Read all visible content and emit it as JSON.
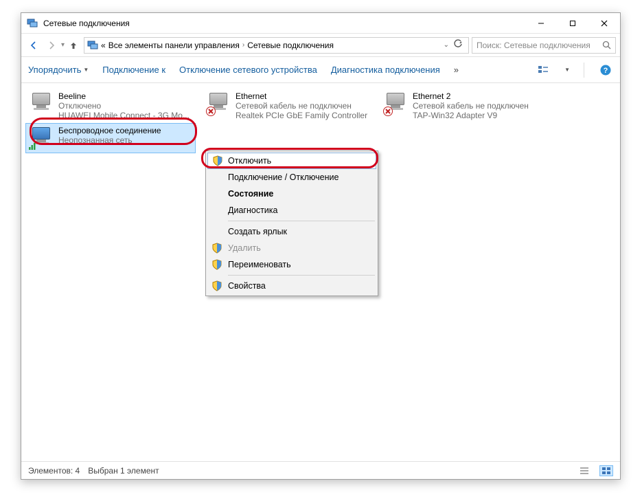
{
  "titlebar": {
    "title": "Сетевые подключения"
  },
  "breadcrumb": {
    "chev_l": "«",
    "seg1": "Все элементы панели управления",
    "seg2": "Сетевые подключения"
  },
  "search": {
    "placeholder": "Поиск: Сетевые подключения"
  },
  "toolbar": {
    "organize": "Упорядочить",
    "connect_to": "Подключение к",
    "disable_device": "Отключение сетевого устройства",
    "diagnose": "Диагностика подключения",
    "more": "»"
  },
  "connections": [
    {
      "name": "Beeline",
      "status": "Отключено",
      "device": "HUAWEI Mobile Connect - 3G Mo...",
      "icon": "gray",
      "overlay": "none"
    },
    {
      "name": "Ethernet",
      "status": "Сетевой кабель не подключен",
      "device": "Realtek PCIe GbE Family Controller",
      "icon": "gray",
      "overlay": "x"
    },
    {
      "name": "Ethernet 2",
      "status": "Сетевой кабель не подключен",
      "device": "TAP-Win32 Adapter V9",
      "icon": "gray",
      "overlay": "x"
    },
    {
      "name": "Беспроводное соединение",
      "status": "Неопознанная сеть",
      "device": "",
      "icon": "blue",
      "overlay": "signal"
    }
  ],
  "context_menu": {
    "disable": "Отключить",
    "connect_disconnect": "Подключение / Отключение",
    "status": "Состояние",
    "diagnose": "Диагностика",
    "create_shortcut": "Создать ярлык",
    "delete": "Удалить",
    "rename": "Переименовать",
    "properties": "Свойства"
  },
  "statusbar": {
    "count": "Элементов: 4",
    "selection": "Выбран 1 элемент"
  }
}
